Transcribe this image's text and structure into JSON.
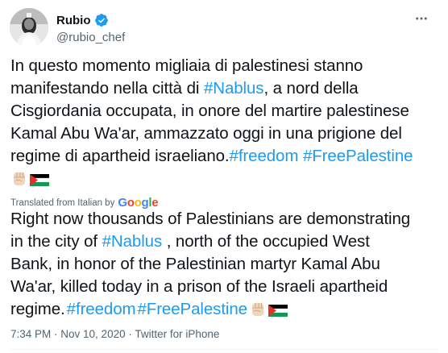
{
  "author": {
    "display_name": "Rubio",
    "handle": "@rubio_chef",
    "verified": true,
    "avatar_icon": "avatar-photo"
  },
  "tweet": {
    "original_lines": [
      "In questo momento migliaia di palestinesi stanno",
      "manifestando nella città di ",
      ", a nord della",
      "Cisgiordania occupata, in onore del martire palestinese",
      "Kamal Abu Wa'ar, ammazzato oggi in una prigione del",
      "regime di apartheid israeliano."
    ],
    "hashtags": {
      "nablus": "#Nablus",
      "freedom": "#freedom",
      "free_palestine": "#FreePalestine"
    },
    "translated_from": "Translated from Italian by",
    "translator": "Google",
    "translation_lines": [
      "Right now thousands of Palestinians are demonstrating",
      "in the city of ",
      " , north of the occupied West",
      "Bank, in honor of the Palestinian martyr Kamal Abu",
      "Wa'ar, killed today in a prison of the Israeli apartheid",
      "regime."
    ],
    "emojis": [
      "raised-fist-icon",
      "palestine-flag-icon"
    ],
    "time": "7:34 PM",
    "date": "Nov 10, 2020",
    "source": "Twitter for iPhone",
    "separator": " · "
  },
  "colors": {
    "link": "#1d9bf0",
    "secondary_text": "#536471",
    "primary_text": "#0f1419"
  }
}
